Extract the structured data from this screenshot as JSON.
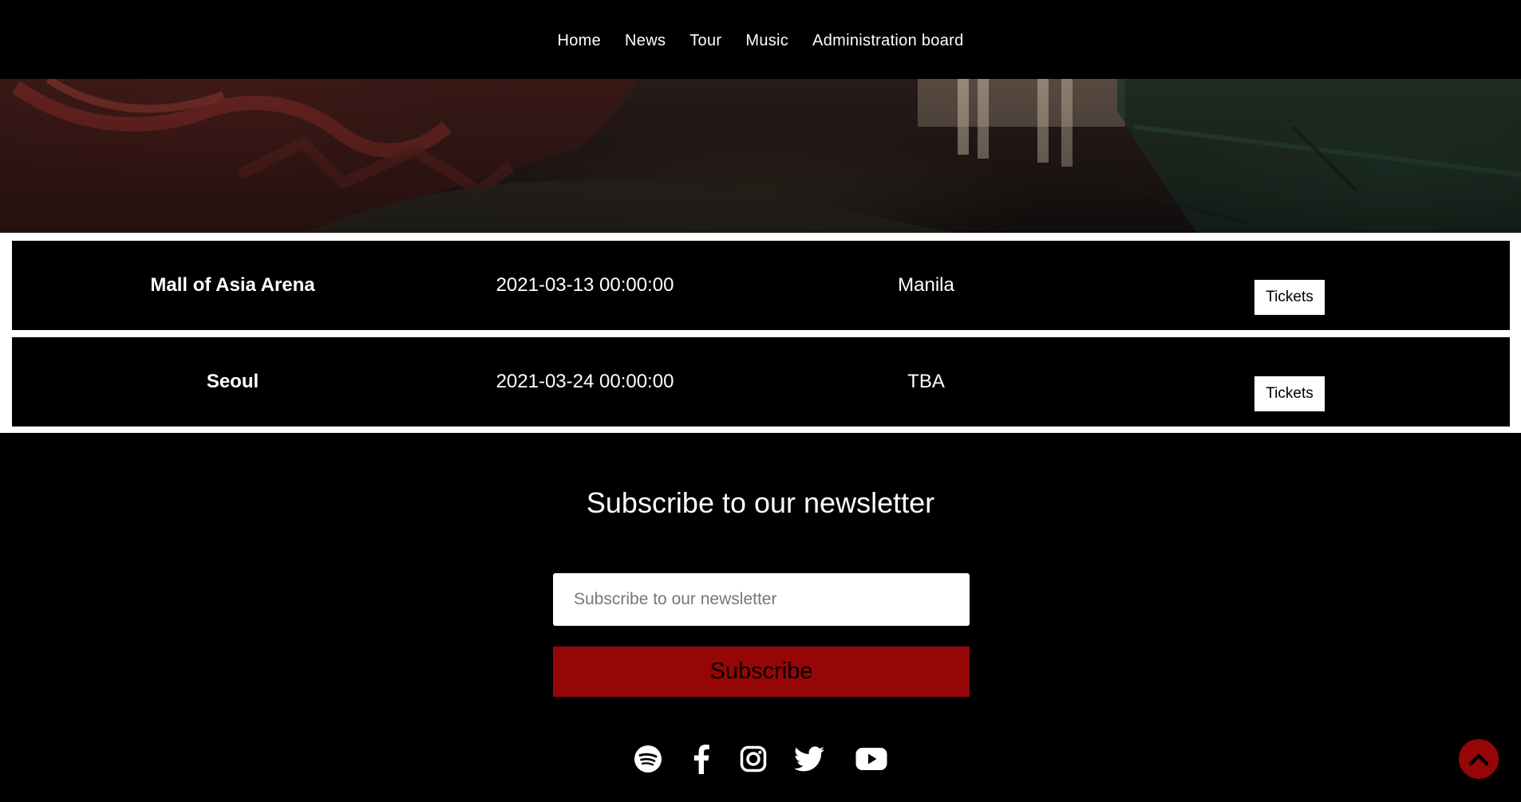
{
  "nav": {
    "items": [
      {
        "label": "Home"
      },
      {
        "label": "News"
      },
      {
        "label": "Tour"
      },
      {
        "label": "Music"
      },
      {
        "label": "Administration board"
      }
    ]
  },
  "tour": {
    "rows": [
      {
        "venue": "Mall of Asia Arena",
        "date": "2021-03-13 00:00:00",
        "city": "Manila",
        "button": "Tickets"
      },
      {
        "venue": "Seoul",
        "date": "2021-03-24 00:00:00",
        "city": "TBA",
        "button": "Tickets"
      }
    ]
  },
  "newsletter": {
    "title": "Subscribe to our newsletter",
    "placeholder": "Subscribe to our newsletter",
    "value": "",
    "button": "Subscribe"
  },
  "social": {
    "icons": [
      "spotify-icon",
      "facebook-icon",
      "instagram-icon",
      "twitter-icon",
      "youtube-icon"
    ]
  },
  "back_to_top": {
    "icon": "chevron-up-icon"
  },
  "colors": {
    "accent": "#960606",
    "background": "#000000",
    "text": "#ffffff"
  }
}
